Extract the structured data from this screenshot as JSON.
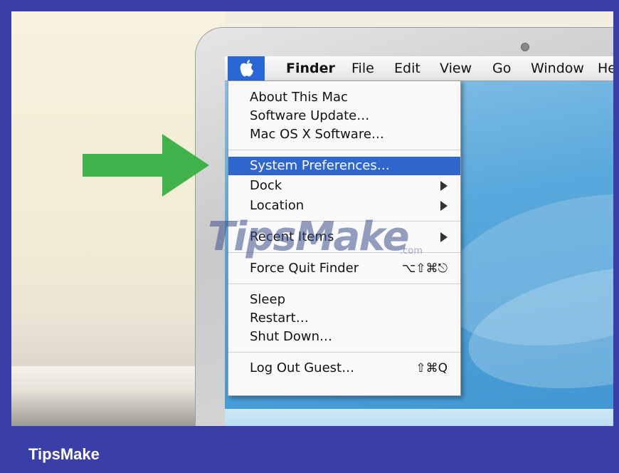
{
  "menubar": {
    "apple_icon": "apple-icon",
    "items": [
      "Finder",
      "File",
      "Edit",
      "View",
      "Go",
      "Window",
      "He"
    ]
  },
  "dropdown": {
    "groups": [
      [
        "About This Mac",
        "Software Update…",
        "Mac OS X Software…"
      ],
      [
        "System Preferences…",
        "Dock",
        "Location"
      ],
      [
        "Recent Items"
      ],
      [
        "Force Quit Finder"
      ],
      [
        "Sleep",
        "Restart…",
        "Shut Down…"
      ],
      [
        "Log Out Guest…"
      ]
    ],
    "shortcuts": {
      "force_quit": "⌥⇧⌘⎋",
      "log_out": "⇧⌘Q"
    },
    "selected_item": "System Preferences…",
    "selection_color": "#2f67cf"
  },
  "arrow": {
    "color": "#3fb24a",
    "icon": "right-arrow-icon"
  },
  "watermark": {
    "text": "TipsMake",
    "sub": ".com"
  },
  "footer": {
    "brand": "TipsMake"
  },
  "colors": {
    "border": "#3a3fa8",
    "screen": "#4a9fd6"
  }
}
